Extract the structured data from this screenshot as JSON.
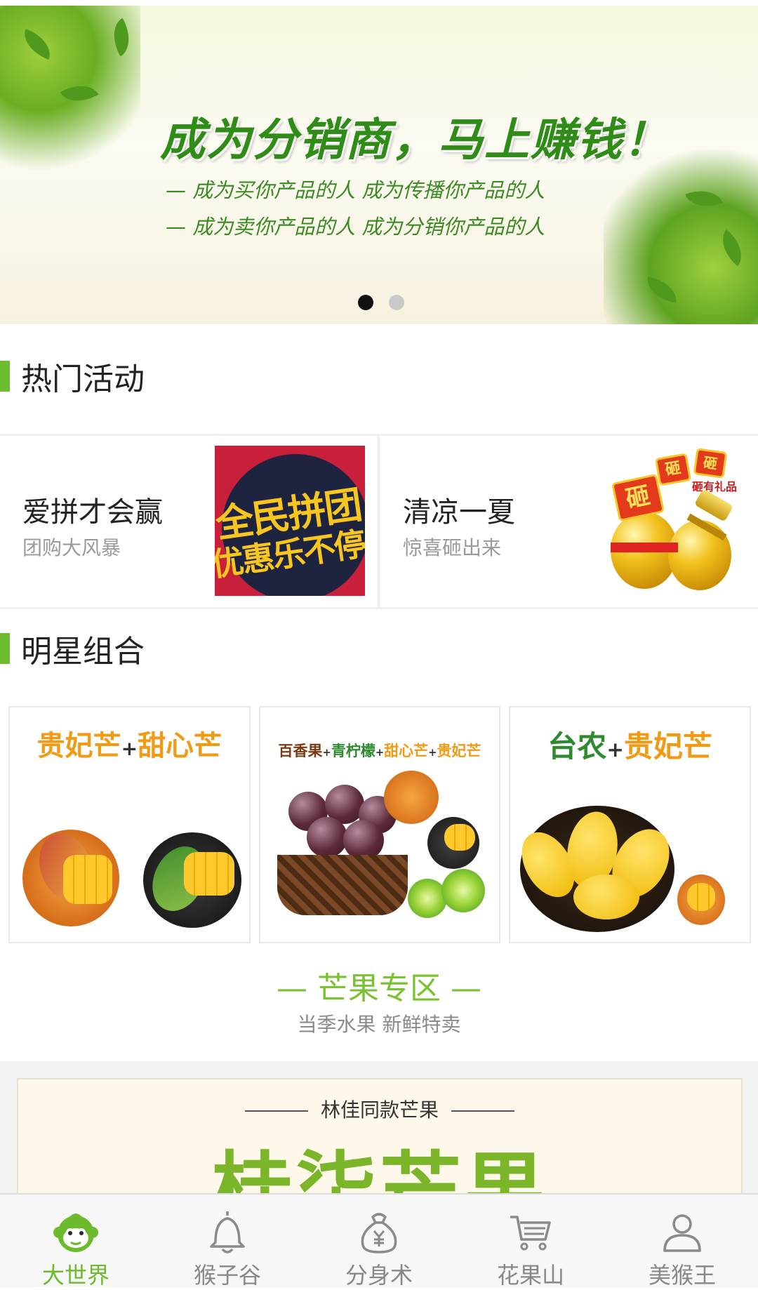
{
  "banner": {
    "title": "成为分销商，马上赚钱！",
    "line1": "— 成为买你产品的人 成为传播你产品的人",
    "line2": "— 成为卖你产品的人 成为分销你产品的人",
    "active_slide": 1,
    "slide_count": 2
  },
  "hot": {
    "title": "热门活动",
    "items": [
      {
        "title": "爱拼才会赢",
        "subtitle": "团购大风暴",
        "poster_line1": "全民拼团",
        "poster_line2": "优惠乐不停"
      },
      {
        "title": "清凉一夏",
        "subtitle": "惊喜砸出来",
        "sign1": "砸",
        "sign2": "砸",
        "sign3": "砸",
        "sign_text": "砸有礼品"
      }
    ]
  },
  "star": {
    "title": "明星组合",
    "combos": [
      {
        "part1": "贵妃芒",
        "plus": "+",
        "part2": "甜心芒"
      },
      {
        "part1": "百香果",
        "p1": "+",
        "part2": "青柠檬",
        "p2": "+",
        "part3": "甜心芒",
        "p3": "+",
        "part4": "贵妃芒"
      },
      {
        "part1": "台农",
        "plus": "+",
        "part2": "贵妃芒"
      }
    ]
  },
  "zone": {
    "title": "— 芒果专区 —",
    "subtitle": "当季水果 新鲜特卖"
  },
  "promo": {
    "subtitle": "林佳同款芒果",
    "big": "桂柒芒果"
  },
  "tabbar": {
    "tabs": [
      {
        "label": "大世界",
        "icon": "monkey-icon",
        "active": true
      },
      {
        "label": "猴子谷",
        "icon": "bell-icon",
        "active": false
      },
      {
        "label": "分身术",
        "icon": "money-bag-icon",
        "active": false
      },
      {
        "label": "花果山",
        "icon": "cart-icon",
        "active": false
      },
      {
        "label": "美猴王",
        "icon": "user-icon",
        "active": false
      }
    ]
  },
  "colors": {
    "accent": "#6dbb2e",
    "active_tab": "#6cbb2c",
    "inactive_tab": "#888888"
  }
}
